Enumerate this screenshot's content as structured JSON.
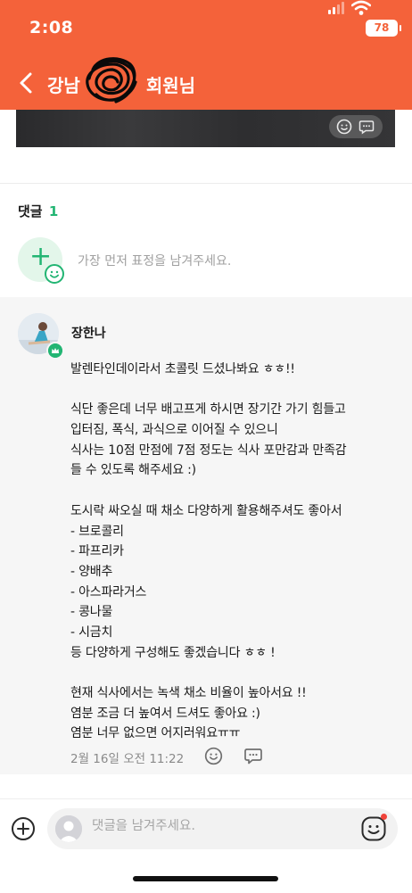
{
  "status_bar": {
    "time": "2:08",
    "battery": "78"
  },
  "nav": {
    "title_prefix": "강남",
    "title_suffix": "회원님"
  },
  "comments": {
    "label": "댓글",
    "count": "1",
    "reaction_placeholder": "가장 먼저 표정을 남겨주세요."
  },
  "comment": {
    "author": "장한나",
    "lines": [
      "발렌타인데이라서 초콜릿 드셨나봐요 ㅎㅎ!!",
      "",
      "식단 좋은데 너무 배고프게 하시면 장기간 가기 힘들고",
      "입터짐, 폭식, 과식으로 이어질 수 있으니",
      "식사는 10점 만점에 7점 정도는 식사 포만감과 만족감",
      "들 수 있도록 해주세요 :)",
      "",
      "도시락 싸오실 때 채소 다양하게 활용해주셔도 좋아서",
      "- 브로콜리",
      "- 파프리카",
      "- 양배추",
      "- 아스파라거스",
      "- 콩나물",
      "- 시금치",
      "등 다양하게 구성해도 좋겠습니다 ㅎㅎ !",
      "",
      "현재 식사에서는 녹색 채소 비율이 높아서요 !!",
      "염분 조금 더 높여서 드셔도 좋아요 :)",
      "염분 너무 없으면 어지러워요ㅠㅠ"
    ],
    "date": "2월 16일 오전 11:22"
  },
  "input": {
    "placeholder": "댓글을 남겨주세요."
  },
  "colors": {
    "header": "#f4623a",
    "accent_green": "#22b573",
    "notification_dot": "#f0433a"
  },
  "icons": [
    "back-arrow-icon",
    "smile-icon",
    "chat-bubble-icon",
    "plus-icon",
    "emoji-icon",
    "crown-icon",
    "signal-icon",
    "wifi-icon",
    "battery-icon"
  ]
}
